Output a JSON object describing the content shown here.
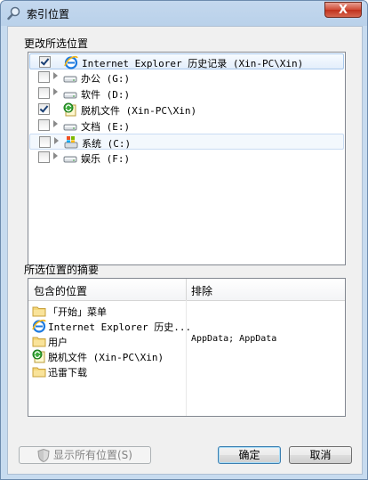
{
  "window": {
    "title": "索引位置",
    "close_label": "X"
  },
  "change_section": {
    "label": "更改所选位置"
  },
  "tree": [
    {
      "label": "Internet Explorer 历史记录 (Xin-PC\\Xin)",
      "checked": true,
      "icon": "ie-icon",
      "state": "sel"
    },
    {
      "label": "办公 (G:)",
      "checked": false,
      "icon": "drive-icon",
      "state": ""
    },
    {
      "label": "软件 (D:)",
      "checked": false,
      "icon": "drive-icon",
      "state": ""
    },
    {
      "label": "脱机文件 (Xin-PC\\Xin)",
      "checked": true,
      "icon": "offline-files-icon",
      "state": ""
    },
    {
      "label": "文档 (E:)",
      "checked": false,
      "icon": "drive-icon",
      "state": ""
    },
    {
      "label": "系统 (C:)",
      "checked": false,
      "icon": "system-drive-icon",
      "state": "hov"
    },
    {
      "label": "娱乐 (F:)",
      "checked": false,
      "icon": "drive-icon",
      "state": ""
    }
  ],
  "summary_section": {
    "label": "所选位置的摘要"
  },
  "summary_table": {
    "columns": [
      "包含的位置",
      "排除"
    ],
    "included": [
      {
        "label": "「开始」菜单",
        "icon": "folder-icon"
      },
      {
        "label": "Internet Explorer 历史...",
        "icon": "ie-icon"
      },
      {
        "label": "用户",
        "icon": "folder-icon"
      },
      {
        "label": "脱机文件 (Xin-PC\\Xin)",
        "icon": "offline-files-icon"
      },
      {
        "label": "迅雷下载",
        "icon": "folder-icon"
      }
    ],
    "excluded": {
      "row": 2,
      "text": "AppData; AppData"
    }
  },
  "buttons": {
    "show_all": "显示所有位置(S)",
    "ok": "确定",
    "cancel": "取消"
  },
  "colors": {
    "title_bg": "#b9d1ea",
    "close_red": "#c0311c",
    "selection_border": "#a8c8ec"
  }
}
